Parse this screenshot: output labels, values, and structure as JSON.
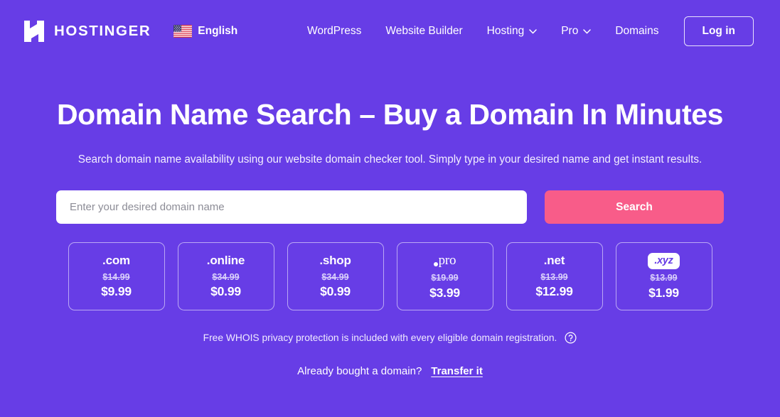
{
  "theme": {
    "background": "#673de6",
    "accent_pink": "#f85c89",
    "text": "#ffffff",
    "muted_text": "#d9cffa"
  },
  "header": {
    "logo_text": "HOSTINGER",
    "logo_icon": "hostinger-h-logo-icon",
    "language": {
      "flag_icon": "us-flag-icon",
      "label": "English"
    },
    "nav": [
      {
        "label": "WordPress",
        "has_chevron": false
      },
      {
        "label": "Website Builder",
        "has_chevron": false
      },
      {
        "label": "Hosting",
        "has_chevron": true
      },
      {
        "label": "Pro",
        "has_chevron": true
      },
      {
        "label": "Domains",
        "has_chevron": false
      }
    ],
    "login_label": "Log in"
  },
  "hero": {
    "title": "Domain Name Search – Buy a Domain In Minutes",
    "subtitle": "Search domain name availability using our website domain checker tool. Simply type in your desired name and get instant results."
  },
  "search": {
    "placeholder": "Enter your desired domain name",
    "value": "",
    "button_label": "Search"
  },
  "tlds": [
    {
      "name": ".com",
      "style": "plain",
      "old_price": "$14.99",
      "new_price": "$9.99"
    },
    {
      "name": ".online",
      "style": "plain",
      "old_price": "$34.99",
      "new_price": "$0.99"
    },
    {
      "name": ".shop",
      "style": "plain",
      "old_price": "$34.99",
      "new_price": "$0.99"
    },
    {
      "name": "pro",
      "style": "pro",
      "old_price": "$19.99",
      "new_price": "$3.99"
    },
    {
      "name": ".net",
      "style": "plain",
      "old_price": "$13.99",
      "new_price": "$12.99"
    },
    {
      "name": ".xyz",
      "style": "xyz",
      "old_price": "$13.99",
      "new_price": "$1.99"
    }
  ],
  "notes": {
    "whois_text": "Free WHOIS privacy protection is included with every eligible domain registration.",
    "whois_help_icon": "question-circle-icon",
    "transfer_question": "Already bought a domain?",
    "transfer_link": "Transfer it"
  }
}
